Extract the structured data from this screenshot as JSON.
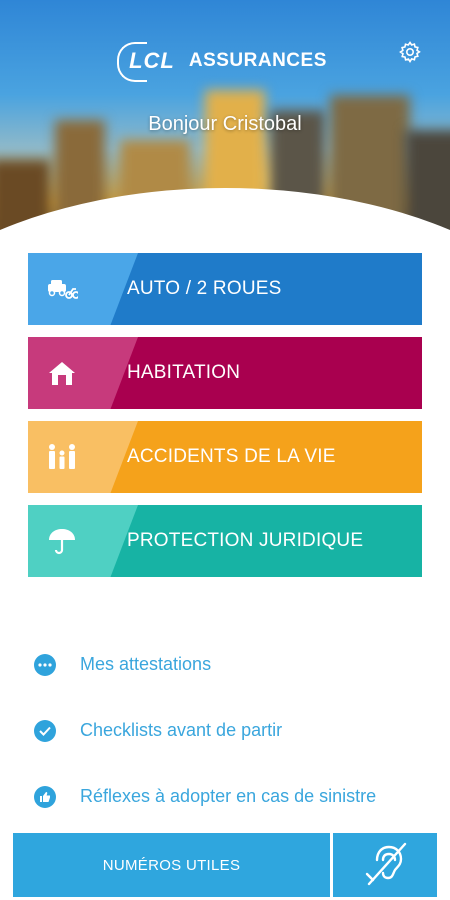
{
  "header": {
    "logo_mark": "LCL",
    "logo_text": "ASSURANCES",
    "greeting": "Bonjour Cristobal"
  },
  "categories": [
    {
      "label": "AUTO / 2 ROUES",
      "icon": "car-icon",
      "color": "#1f7bc9"
    },
    {
      "label": "HABITATION",
      "icon": "house-icon",
      "color": "#a9004f"
    },
    {
      "label": "ACCIDENTS DE LA VIE",
      "icon": "family-icon",
      "color": "#f5a21b"
    },
    {
      "label": "PROTECTION JURIDIQUE",
      "icon": "umbrella-icon",
      "color": "#17b3a4"
    }
  ],
  "links": [
    {
      "label": "Mes attestations",
      "icon": "more-dots-icon"
    },
    {
      "label": "Checklists avant de partir",
      "icon": "check-circle-icon"
    },
    {
      "label": "Réflexes à adopter en cas de sinistre",
      "icon": "thumbs-up-icon"
    }
  ],
  "footer": {
    "numbers_label": "NUMÉROS UTILES",
    "accessibility_icon": "hearing-impaired-icon"
  },
  "colors": {
    "accent": "#2fa6de"
  }
}
